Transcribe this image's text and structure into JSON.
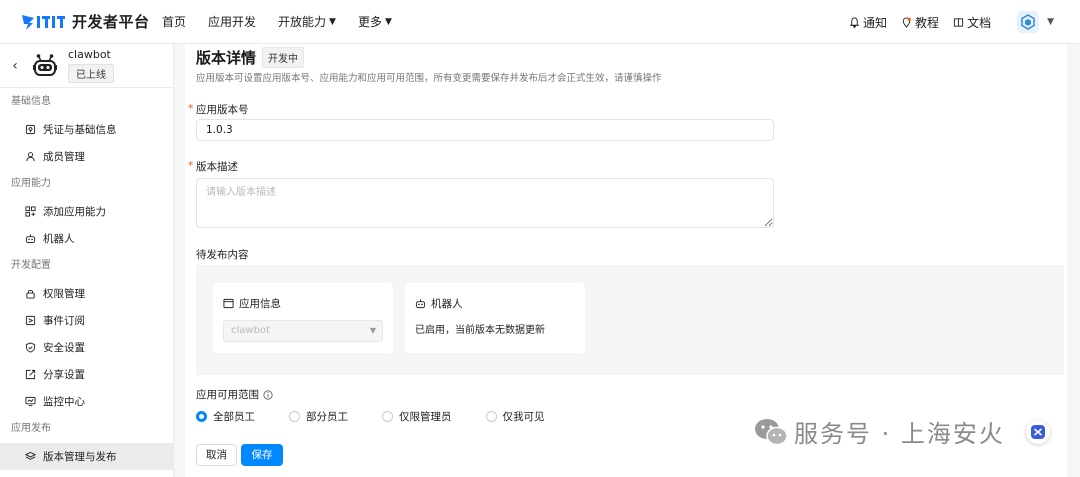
{
  "brand": {
    "name": "开发者平台"
  },
  "nav": [
    {
      "label": "首页"
    },
    {
      "label": "应用开发"
    },
    {
      "label": "开放能力",
      "has_menu": true
    },
    {
      "label": "更多",
      "has_menu": true
    }
  ],
  "top_right": {
    "notify": "通知",
    "tutorial": "教程",
    "docs": "文档"
  },
  "app": {
    "name": "clawbot",
    "status": "已上线"
  },
  "sidebar": {
    "groups": [
      {
        "title": "基础信息",
        "items": [
          {
            "label": "凭证与基础信息",
            "icon": "credential-icon"
          },
          {
            "label": "成员管理",
            "icon": "user-icon"
          }
        ]
      },
      {
        "title": "应用能力",
        "items": [
          {
            "label": "添加应用能力",
            "icon": "grid-plus-icon"
          },
          {
            "label": "机器人",
            "icon": "robot-icon"
          }
        ]
      },
      {
        "title": "开发配置",
        "items": [
          {
            "label": "权限管理",
            "icon": "lock-icon"
          },
          {
            "label": "事件订阅",
            "icon": "event-icon"
          },
          {
            "label": "安全设置",
            "icon": "shield-icon"
          },
          {
            "label": "分享设置",
            "icon": "share-icon"
          },
          {
            "label": "监控中心",
            "icon": "monitor-icon"
          }
        ]
      },
      {
        "title": "应用发布",
        "items": [
          {
            "label": "版本管理与发布",
            "icon": "layers-icon",
            "active": true
          }
        ]
      }
    ]
  },
  "page": {
    "title": "版本详情",
    "badge": "开发中",
    "description": "应用版本可设置应用版本号、应用能力和应用可用范围，所有变更需要保存并发布后才会正式生效，请谨慎操作",
    "version_label": "应用版本号",
    "version_value": "1.0.3",
    "desc_label": "版本描述",
    "desc_placeholder": "请输入版本描述",
    "pending_label": "待发布内容",
    "cards": {
      "app_info": {
        "title": "应用信息",
        "select_value": "clawbot"
      },
      "robot": {
        "title": "机器人",
        "text": "已启用，当前版本无数据更新"
      }
    },
    "scope_label": "应用可用范围",
    "scope_options": [
      {
        "label": "全部员工",
        "selected": true
      },
      {
        "label": "部分员工",
        "selected": false
      },
      {
        "label": "仅限管理员",
        "selected": false
      },
      {
        "label": "仅我可见",
        "selected": false
      }
    ],
    "cancel": "取消",
    "save": "保存"
  },
  "watermark": {
    "text": "服务号 · 上海安火"
  },
  "colors": {
    "primary": "#0089ff",
    "required": "#ff5219"
  }
}
